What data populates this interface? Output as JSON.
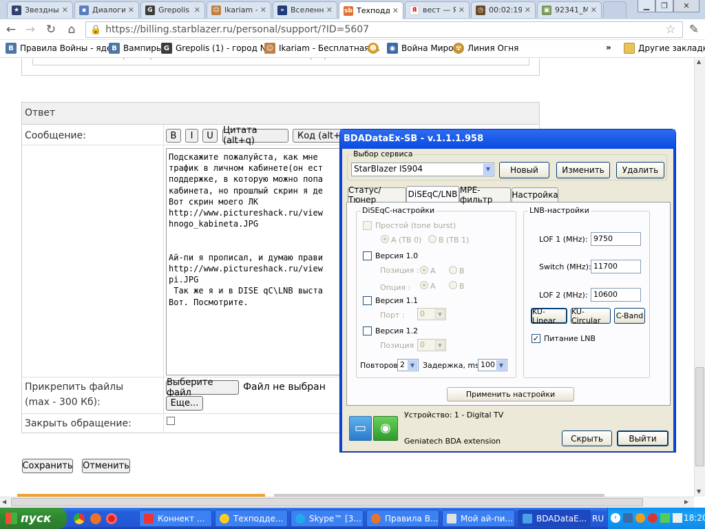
{
  "tabs": [
    {
      "title": "Звездные",
      "icon": "stars-game-icon"
    },
    {
      "title": "Диалоги",
      "icon": "dialog-icon"
    },
    {
      "title": "Grepolis (",
      "icon": "grepolis-icon"
    },
    {
      "title": "Ikariam - ",
      "icon": "ikariam-icon"
    },
    {
      "title": "Вселенна",
      "icon": "universe-icon"
    },
    {
      "title": "Техподд",
      "icon": "starblazer-icon"
    },
    {
      "title": "вест — Я",
      "icon": "yandex-icon"
    },
    {
      "title": "00:02:19",
      "icon": "timer-icon"
    },
    {
      "title": "92341_M",
      "icon": "image-icon"
    }
  ],
  "address": {
    "url": "https://billing.starblazer.ru/personal/support/?ID=5607"
  },
  "bookmarks": [
    "Правила Войны - яде...",
    "Вампиры",
    "Grepolis (1) - город N...",
    "Ikariam - Бесплатная ...",
    "",
    "Война Миров",
    "Линия Огня"
  ],
  "bookmarks_more": "»",
  "other_bookmarks": "Другие закладки",
  "page": {
    "prev_text": "на закладке MPE фильтр, должен попытьвсп входящий трафик.",
    "answer_header": "Ответ",
    "message_label": "Сообщение:",
    "editor_buttons": [
      "B",
      "I",
      "U",
      "Цитата (alt+q)",
      "Код (alt+c"
    ],
    "message_text": "Подскажите пожалуйста, как мне \nтрафик в личном кабинете(он ест\nподдержке, в которую можно попа\nкабинета, но прошлый скрин я де\nВот скрин моего ЛК\nhttp://www.pictureshack.ru/view\nhnogo_kabineta.JPG\n\n\nАй-пи я прописал, и думаю прави\nhttp://www.pictureshack.ru/view\npi.JPG\n Так же я и в DISE qC\\LNB выста\nВот. Посмотрите.",
    "attach_label_1": "Прикрепить файлы",
    "attach_label_2": "(max - 300 Кб):",
    "choose_file": "Выберите файл",
    "no_file": "Файл не выбран",
    "more": "Еще...",
    "close_label": "Закрыть обращение:",
    "save": "Сохранить",
    "cancel": "Отменить"
  },
  "dialog": {
    "title": "BDADataEx-SB - v.1.1.1.958",
    "service_group": "Выбор сервиса",
    "service_value": "StarBlazer IS904",
    "btn_new": "Новый",
    "btn_edit": "Изменить",
    "btn_delete": "Удалить",
    "tabs": [
      "Статус/Тюнер",
      "DiSEqC/LNB",
      "MPE-фильтр",
      "Настройка"
    ],
    "diseqc_group": "DiSEqC-настройки",
    "simple": "Простой (tone burst)",
    "a_tb0": "A (TB 0)",
    "b_tb1": "B (TB 1)",
    "v10": "Версия 1.0",
    "position": "Позиция :",
    "option": "Опция :",
    "a": "A",
    "b": "B",
    "v11": "Версия 1.1",
    "port": "Порт :",
    "v12": "Версия 1.2",
    "position2": "Позиция :",
    "zero": "0",
    "repeats_label": "Повторов:",
    "repeats": "2",
    "delay_label": "Задержка, ms:",
    "delay": "100",
    "lnb_group": "LNB-настройки",
    "lof1_label": "LOF 1 (MHz):",
    "lof1": "9750",
    "switch_label": "Switch (MHz):",
    "switch": "11700",
    "lof2_label": "LOF 2 (MHz):",
    "lof2": "10600",
    "ku_linear": "KU-Linear",
    "ku_circular": "KU-Circular",
    "c_band": "C-Band",
    "lnb_power": "Питание LNB",
    "apply": "Применить настройки",
    "device": "Устройство: 1 - Digital TV",
    "extension": "Geniatech BDA extension",
    "hide": "Скрыть",
    "exit": "Выйти"
  },
  "taskbar": {
    "start": "пуск",
    "tasks": [
      "Коннект ...",
      "Техподде...",
      "Skype™ [3...",
      "Правила В...",
      "Мой ай-пи...",
      "BDADataE..."
    ],
    "lang": "RU",
    "clock": "18:20"
  }
}
